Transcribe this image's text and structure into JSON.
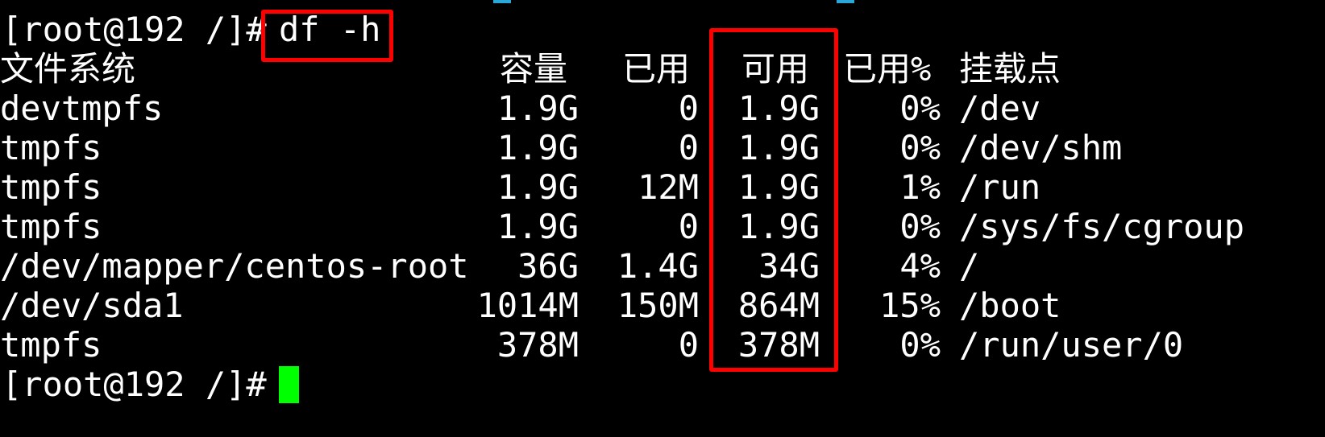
{
  "terminal": {
    "command_line": {
      "prompt": "[root@192 /]# ",
      "command": "df -h"
    },
    "headers": {
      "filesystem": "文件系统",
      "size": "容量",
      "used": "已用",
      "available": "可用",
      "use_percent": "已用%",
      "mounted_on": "挂载点"
    },
    "rows": [
      {
        "filesystem": "devtmpfs",
        "size": "1.9G",
        "used": "0",
        "available": "1.9G",
        "use_percent": "0%",
        "mounted_on": "/dev"
      },
      {
        "filesystem": "tmpfs",
        "size": "1.9G",
        "used": "0",
        "available": "1.9G",
        "use_percent": "0%",
        "mounted_on": "/dev/shm"
      },
      {
        "filesystem": "tmpfs",
        "size": "1.9G",
        "used": "12M",
        "available": "1.9G",
        "use_percent": "1%",
        "mounted_on": "/run"
      },
      {
        "filesystem": "tmpfs",
        "size": "1.9G",
        "used": "0",
        "available": "1.9G",
        "use_percent": "0%",
        "mounted_on": "/sys/fs/cgroup"
      },
      {
        "filesystem": "/dev/mapper/centos-root",
        "size": "36G",
        "used": "1.4G",
        "available": "34G",
        "use_percent": "4%",
        "mounted_on": "/"
      },
      {
        "filesystem": "/dev/sda1",
        "size": "1014M",
        "used": "150M",
        "available": "864M",
        "use_percent": "15%",
        "mounted_on": "/boot"
      },
      {
        "filesystem": "tmpfs",
        "size": "378M",
        "used": "0",
        "available": "378M",
        "use_percent": "0%",
        "mounted_on": "/run/user/0"
      }
    ],
    "final_prompt": "[root@192 /]# ",
    "colors": {
      "background": "#000000",
      "text": "#ffffff",
      "highlight_border": "#ff0000",
      "cursor": "#00ff00"
    }
  }
}
